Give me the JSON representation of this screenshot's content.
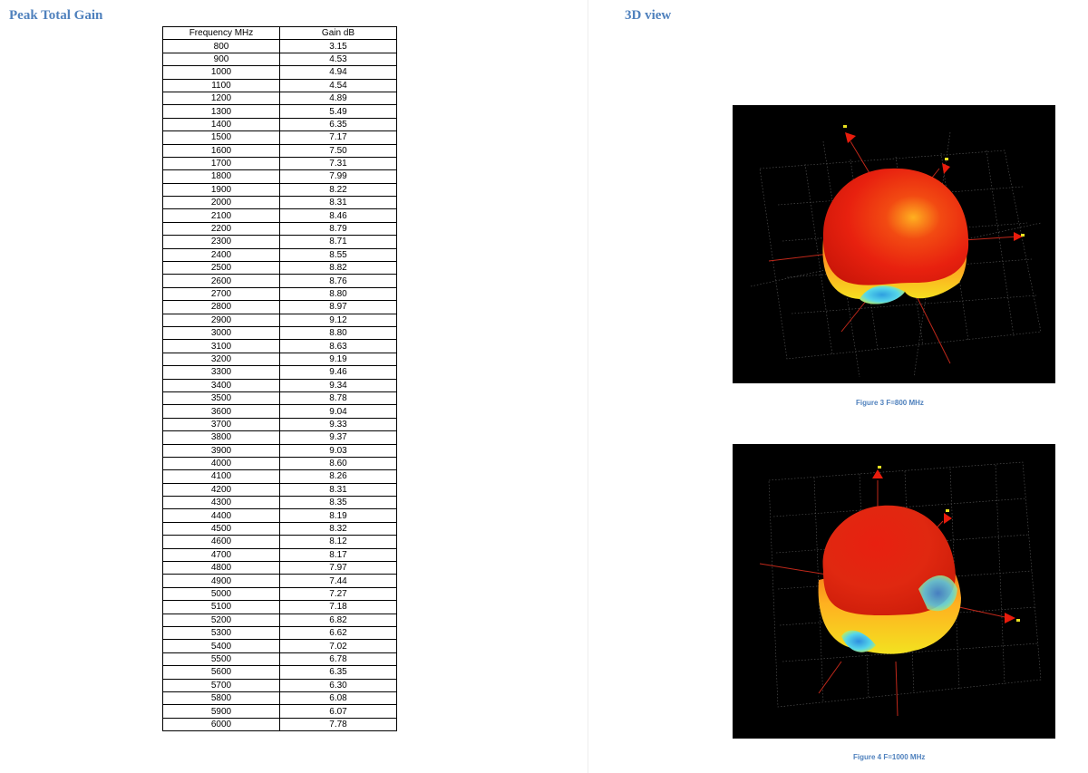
{
  "left_page": {
    "title": "Peak Total Gain",
    "table": {
      "headers": [
        "Frequency MHz",
        "Gain dB"
      ],
      "rows": [
        [
          "800",
          "3.15"
        ],
        [
          "900",
          "4.53"
        ],
        [
          "1000",
          "4.94"
        ],
        [
          "1100",
          "4.54"
        ],
        [
          "1200",
          "4.89"
        ],
        [
          "1300",
          "5.49"
        ],
        [
          "1400",
          "6.35"
        ],
        [
          "1500",
          "7.17"
        ],
        [
          "1600",
          "7.50"
        ],
        [
          "1700",
          "7.31"
        ],
        [
          "1800",
          "7.99"
        ],
        [
          "1900",
          "8.22"
        ],
        [
          "2000",
          "8.31"
        ],
        [
          "2100",
          "8.46"
        ],
        [
          "2200",
          "8.79"
        ],
        [
          "2300",
          "8.71"
        ],
        [
          "2400",
          "8.55"
        ],
        [
          "2500",
          "8.82"
        ],
        [
          "2600",
          "8.76"
        ],
        [
          "2700",
          "8.80"
        ],
        [
          "2800",
          "8.97"
        ],
        [
          "2900",
          "9.12"
        ],
        [
          "3000",
          "8.80"
        ],
        [
          "3100",
          "8.63"
        ],
        [
          "3200",
          "9.19"
        ],
        [
          "3300",
          "9.46"
        ],
        [
          "3400",
          "9.34"
        ],
        [
          "3500",
          "8.78"
        ],
        [
          "3600",
          "9.04"
        ],
        [
          "3700",
          "9.33"
        ],
        [
          "3800",
          "9.37"
        ],
        [
          "3900",
          "9.03"
        ],
        [
          "4000",
          "8.60"
        ],
        [
          "4100",
          "8.26"
        ],
        [
          "4200",
          "8.31"
        ],
        [
          "4300",
          "8.35"
        ],
        [
          "4400",
          "8.19"
        ],
        [
          "4500",
          "8.32"
        ],
        [
          "4600",
          "8.12"
        ],
        [
          "4700",
          "8.17"
        ],
        [
          "4800",
          "7.97"
        ],
        [
          "4900",
          "7.44"
        ],
        [
          "5000",
          "7.27"
        ],
        [
          "5100",
          "7.18"
        ],
        [
          "5200",
          "6.82"
        ],
        [
          "5300",
          "6.62"
        ],
        [
          "5400",
          "7.02"
        ],
        [
          "5500",
          "6.78"
        ],
        [
          "5600",
          "6.35"
        ],
        [
          "5700",
          "6.30"
        ],
        [
          "5800",
          "6.08"
        ],
        [
          "5900",
          "6.07"
        ],
        [
          "6000",
          "7.78"
        ]
      ]
    }
  },
  "right_page": {
    "title": "3D view",
    "figures": [
      {
        "caption": "Figure 3  F=800 MHz"
      },
      {
        "caption": "Figure 4  F=1000 MHz"
      }
    ]
  },
  "colors": {
    "heading": "#4f81bd",
    "pattern_red": "#e8210f",
    "pattern_yellow": "#f2e01c",
    "pattern_cyan": "#3fc8e6",
    "plot_background": "#000000"
  }
}
